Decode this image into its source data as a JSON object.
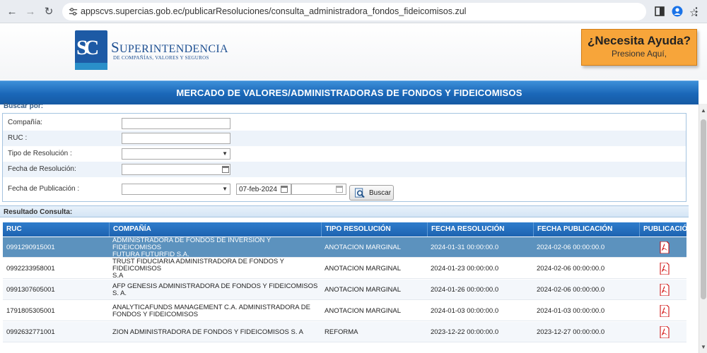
{
  "browser": {
    "url": "appscvs.supercias.gob.ec/publicarResoluciones/consulta_administradora_fondos_fideicomisos.zul"
  },
  "header": {
    "logo_letters": "SC",
    "org_title_cap": "S",
    "org_title_rest": "UPERINTENDENCIA",
    "org_subtitle": "DE COMPAÑÍAS, VALORES Y SEGUROS",
    "help_title": "¿Necesita Ayuda?",
    "help_subtitle": "Presione Aquí,",
    "help_color": "#f7a53a"
  },
  "banner": {
    "title": "MERCADO DE VALORES/ADMINISTRADORAS DE FONDOS Y FIDEICOMISOS",
    "color": "#1a67b8"
  },
  "search": {
    "legend": "Buscar por:",
    "fields": {
      "company_label": "Compañía:",
      "company_value": "",
      "ruc_label": "RUC :",
      "ruc_value": "",
      "resolution_type_label": "Tipo de Resolución :",
      "resolution_type_value": "",
      "resolution_date_label": "Fecha de Resolución:",
      "resolution_date_value": "",
      "publication_date_label": "Fecha de Publicación :",
      "publication_mode_value": "",
      "publication_from_value": "07-feb-2024",
      "publication_to_value": ""
    },
    "button_label": "Buscar"
  },
  "results": {
    "title": "Resultado Consulta:",
    "columns": [
      "RUC",
      "COMPAÑÍA",
      "TIPO RESOLUCIÓN",
      "FECHA RESOLUCIÓN",
      "FECHA PUBLICACIÓN",
      "PUBLICACIÓN"
    ],
    "rows": [
      {
        "ruc": "0991290915001",
        "company_line1": "ADMINISTRADORA DE FONDOS DE INVERSION Y FIDEICOMISOS",
        "company_line2": "FUTURA FUTURFID S.A.",
        "type": "ANOTACION MARGINAL",
        "resolution_date": "2024-01-31 00:00:00.0",
        "publication_date": "2024-02-06 00:00:00.0",
        "selected": true
      },
      {
        "ruc": "0992233958001",
        "company_line1": "TRUST FIDUCIARIA ADMINISTRADORA DE FONDOS Y FIDEICOMISOS",
        "company_line2": "S.A",
        "type": "ANOTACION MARGINAL",
        "resolution_date": "2024-01-23 00:00:00.0",
        "publication_date": "2024-02-06 00:00:00.0",
        "selected": false
      },
      {
        "ruc": "0991307605001",
        "company_line1": "AFP GENESIS ADMINISTRADORA DE FONDOS Y FIDEICOMISOS S. A.",
        "company_line2": "",
        "type": "ANOTACION MARGINAL",
        "resolution_date": "2024-01-26 00:00:00.0",
        "publication_date": "2024-02-06 00:00:00.0",
        "selected": false
      },
      {
        "ruc": "1791805305001",
        "company_line1": "ANALYTICAFUNDS MANAGEMENT C.A. ADMINISTRADORA DE",
        "company_line2": "FONDOS Y FIDEICOMISOS",
        "type": "ANOTACION MARGINAL",
        "resolution_date": "2024-01-03 00:00:00.0",
        "publication_date": "2024-01-03 00:00:00.0",
        "selected": false
      },
      {
        "ruc": "0992632771001",
        "company_line1": "ZION ADMINISTRADORA DE FONDOS Y FIDEICOMISOS S. A",
        "company_line2": "",
        "type": "REFORMA",
        "resolution_date": "2023-12-22 00:00:00.0",
        "publication_date": "2023-12-27 00:00:00.0",
        "selected": false
      }
    ]
  }
}
